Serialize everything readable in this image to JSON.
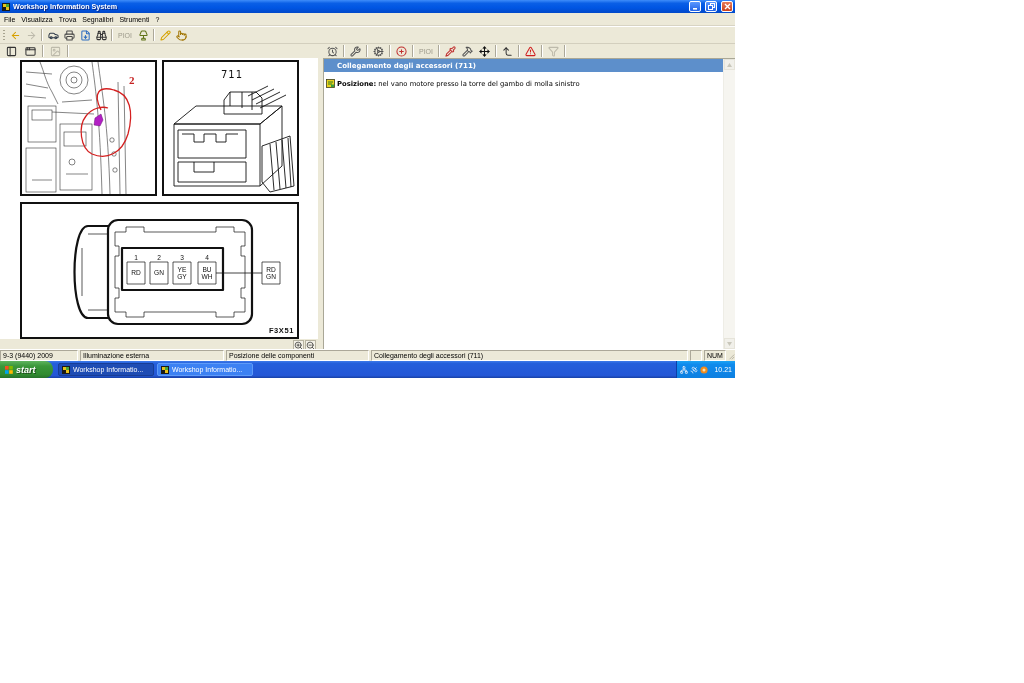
{
  "window": {
    "title": "Workshop Information System"
  },
  "menu": [
    "File",
    "Visualizza",
    "Trova",
    "Segnalibri",
    "Strumenti",
    "?"
  ],
  "main_toolbar": {
    "groups": [
      [
        {
          "disabled": false
        },
        {
          "disabled": true
        }
      ],
      [
        {
          "disabled": false
        },
        {
          "disabled": false
        },
        {
          "disabled": false
        },
        {
          "disabled": false
        }
      ],
      [
        {
          "label": "PIOI",
          "disabled": true
        },
        {
          "disabled": false
        }
      ],
      [
        {
          "disabled": false
        },
        {
          "disabled": false
        }
      ]
    ]
  },
  "view_toolbar": {
    "groups": [
      [
        {
          "disabled": false
        },
        {
          "disabled": false
        }
      ],
      [
        {
          "disabled": true
        }
      ]
    ]
  },
  "document_toolbar": {
    "groups": [
      [
        {
          "disabled": false
        }
      ],
      [
        {
          "disabled": false
        }
      ],
      [
        {
          "disabled": false
        }
      ],
      [
        {
          "disabled": false
        }
      ],
      [
        {
          "label": "PIOI",
          "disabled": true
        }
      ],
      [
        {
          "disabled": false
        },
        {
          "disabled": false
        },
        {
          "disabled": false
        }
      ],
      [
        {
          "disabled": false
        }
      ],
      [
        {
          "disabled": false
        }
      ],
      [
        {
          "disabled": true
        }
      ]
    ]
  },
  "figures": {
    "location_view": {
      "callout": "2"
    },
    "connector_view": {
      "connector_number": "711"
    },
    "pinout_view": {
      "pins": [
        {
          "number": "1",
          "wire": [
            "RD"
          ]
        },
        {
          "number": "2",
          "wire": [
            "GN"
          ]
        },
        {
          "number": "3",
          "wire": [
            "YE",
            "GY"
          ]
        },
        {
          "number": "4",
          "wire": [
            "BU",
            "WH"
          ]
        }
      ],
      "external_wire": [
        "RD",
        "GN"
      ],
      "figure_code": "F3X51"
    }
  },
  "document": {
    "heading": "Collegamento degli accessori (711)",
    "entries": [
      "**Posizione:** nel vano motore presso la torre del gambo di molla sinistro"
    ]
  },
  "status_bar": {
    "panes": [
      "9-3 (9440) 2009",
      "Illuminazione esterna",
      "Posizione delle componenti",
      "Collegamento degli accessori (711)"
    ],
    "indicators": [
      "NUM"
    ]
  },
  "taskbar": {
    "start_label": "start",
    "tasks": [
      {
        "label": "Workshop Informatio...",
        "selected": true
      },
      {
        "label": "Workshop Informatio...",
        "selected": false
      }
    ],
    "clock": "10.21"
  }
}
